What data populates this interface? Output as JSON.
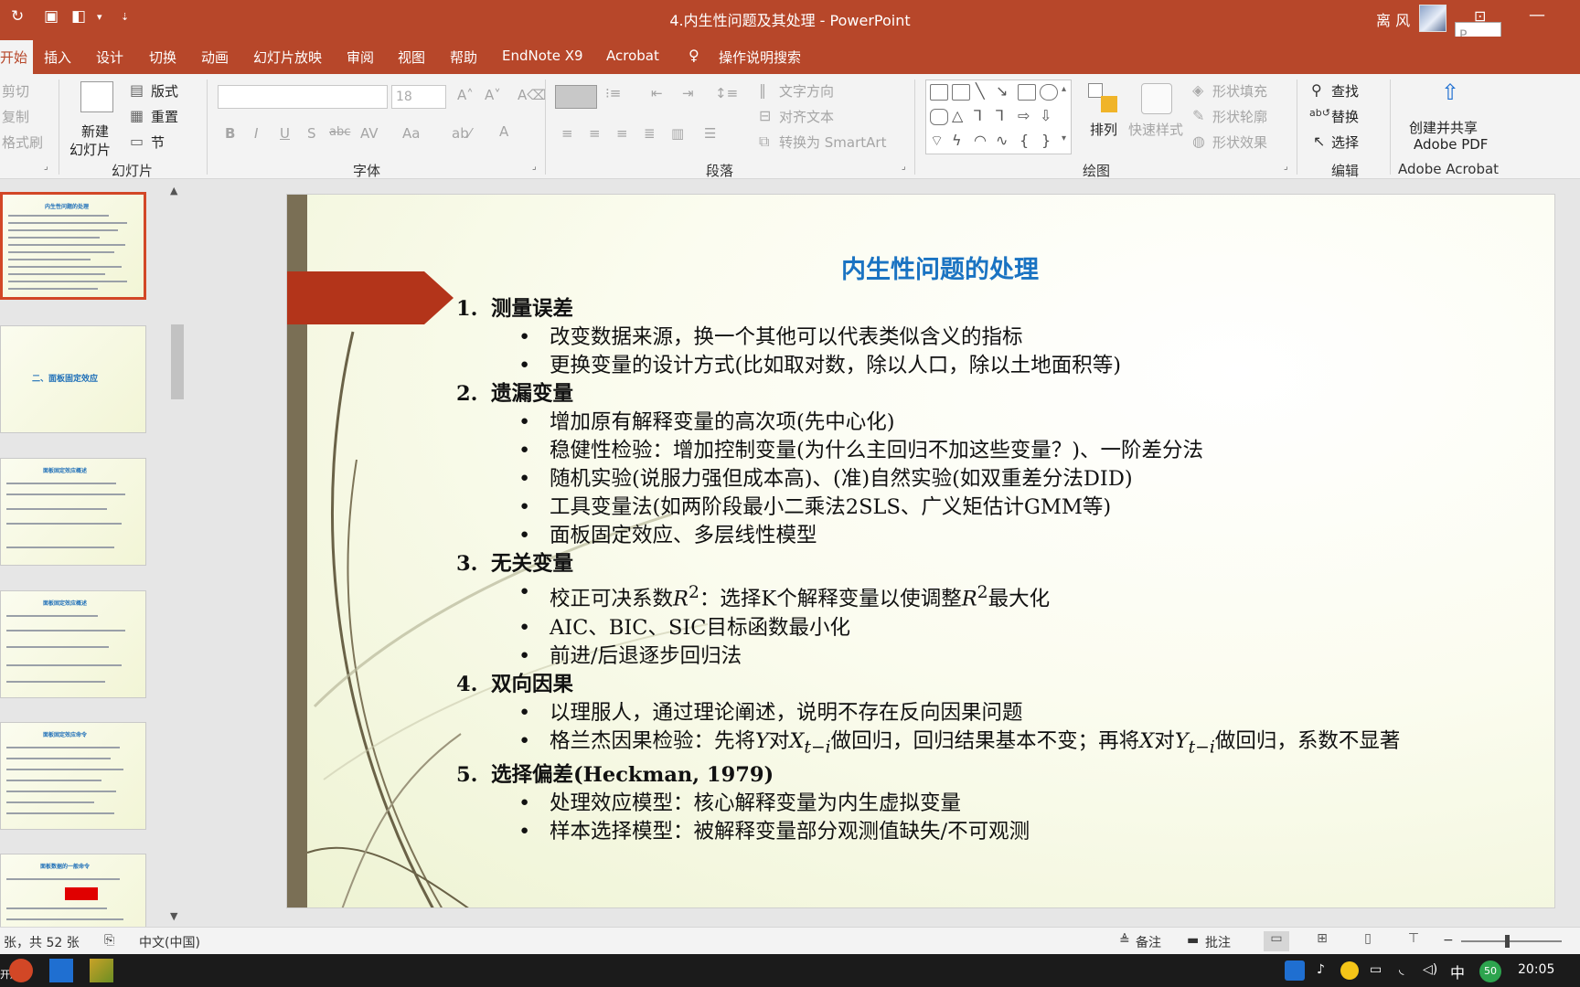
{
  "titlebar": {
    "title": "4.内生性问题及其处理  -  PowerPoint",
    "user": "离 风",
    "search_popup": "P...",
    "tooltip": "开始"
  },
  "tabs": [
    "开始",
    "插入",
    "设计",
    "切换",
    "动画",
    "幻灯片放映",
    "审阅",
    "视图",
    "帮助",
    "EndNote X9",
    "Acrobat",
    "操作说明搜索"
  ],
  "ribbon": {
    "clipboard": {
      "cut": "剪切",
      "copy": "复制",
      "format_painter": "格式刷"
    },
    "slides": {
      "new_slide": "新建",
      "new_slide_2": "幻灯片",
      "layout": "版式",
      "reset": "重置",
      "section": "节",
      "label": "幻灯片"
    },
    "font": {
      "size_value": "18",
      "bold": "B",
      "italic": "I",
      "underline": "U",
      "shadow": "S",
      "strike": "abc",
      "spacing": "AV",
      "case": "Aa",
      "color": "A",
      "label": "字体"
    },
    "paragraph": {
      "text_direction": "文字方向",
      "align_text": "对齐文本",
      "smartart": "转换为 SmartArt",
      "label": "段落"
    },
    "drawing": {
      "arrange": "排列",
      "quick_styles": "快速样式",
      "shape_fill": "形状填充",
      "shape_outline": "形状轮廓",
      "shape_effects": "形状效果",
      "label": "绘图"
    },
    "editing": {
      "find": "查找",
      "replace": "替换",
      "select": "选择",
      "label": "编辑"
    },
    "acrobat": {
      "create_share": "创建并共享",
      "adobe_pdf": "Adobe PDF",
      "label": "Adobe Acrobat"
    }
  },
  "thumbnails": [
    {
      "title": "内生性问题的处理",
      "selected": true
    },
    {
      "title": "二、面板固定效应",
      "selected": false
    },
    {
      "title": "面板固定效应概述",
      "selected": false
    },
    {
      "title": "面板固定效应概述",
      "selected": false
    },
    {
      "title": "面板固定效应命令",
      "selected": false
    },
    {
      "title": "面板数据的一般命令",
      "selected": false
    }
  ],
  "slide": {
    "title": "内生性问题的处理",
    "sections": [
      {
        "num": "1.",
        "head": "测量误差",
        "items": [
          "改变数据来源，换一个其他可以代表类似含义的指标",
          "更换变量的设计方式(比如取对数，除以人口，除以土地面积等)"
        ]
      },
      {
        "num": "2.",
        "head": "遗漏变量",
        "items": [
          "增加原有解释变量的高次项(先中心化)",
          "稳健性检验：增加控制变量(为什么主回归不加这些变量？)、一阶差分法",
          "随机实验(说服力强但成本高)、(准)自然实验(如双重差分法DID)",
          "工具变量法(如两阶段最小二乘法2SLS、广义矩估计GMM等)",
          "面板固定效应、多层线性模型"
        ]
      },
      {
        "num": "3.",
        "head": "无关变量",
        "r2_item": {
          "a": "校正可决系数",
          "b": "：选择K个解释变量以使调整",
          "c": "最大化",
          "sym": "R",
          "sup": "2"
        },
        "items": [
          "AIC、BIC、SIC目标函数最小化",
          "前进/后退逐步回归法"
        ]
      },
      {
        "num": "4.",
        "head": "双向因果",
        "items": [
          "以理服人，通过理论阐述，说明不存在反向因果问题"
        ],
        "granger": {
          "a": "格兰杰因果检验：先将",
          "y": "Y",
          "dui": "对",
          "x": "X",
          "sub": "t−i",
          "b": "做回归，回归结果基本不变；再将",
          "c": "做回归，系数不显著"
        }
      },
      {
        "num": "5.",
        "head": "选择偏差(Heckman, 1979)",
        "items": [
          "处理效应模型：核心解释变量为内生虚拟变量",
          "样本选择模型：被解释变量部分观测值缺失/不可观测"
        ]
      }
    ]
  },
  "statusbar": {
    "slide_count": "张，共 52 张",
    "language": "中文(中国)",
    "notes": "备注",
    "comments": "批注"
  },
  "taskbar": {
    "start": "开屏",
    "ime": "中",
    "badge": "50",
    "time": "20:05"
  },
  "colors": {
    "accent": "#b7472a",
    "slide_title": "#1a73c2",
    "arrow": "#b3341a"
  }
}
